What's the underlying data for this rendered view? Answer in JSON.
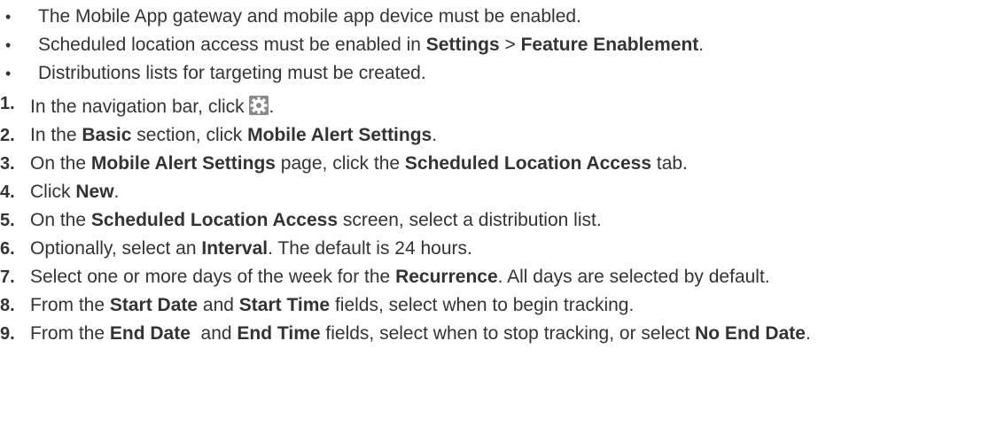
{
  "prerequisites": [
    {
      "parts": [
        {
          "t": "The Mobile App gateway and mobile app device must be enabled.",
          "b": false
        }
      ]
    },
    {
      "parts": [
        {
          "t": "Scheduled location access must be enabled in ",
          "b": false
        },
        {
          "t": "Settings",
          "b": true
        },
        {
          "t": " > ",
          "b": false
        },
        {
          "t": "Feature Enablement",
          "b": true
        },
        {
          "t": ".",
          "b": false
        }
      ]
    },
    {
      "parts": [
        {
          "t": "Distributions lists for targeting must be created.",
          "b": false
        }
      ]
    }
  ],
  "steps": [
    {
      "num": "1.",
      "parts": [
        {
          "t": "In the navigation bar, click ",
          "b": false
        },
        {
          "icon": "gear-icon"
        },
        {
          "t": ".",
          "b": false
        }
      ]
    },
    {
      "num": "2.",
      "parts": [
        {
          "t": "In the ",
          "b": false
        },
        {
          "t": "Basic",
          "b": true
        },
        {
          "t": " section, click ",
          "b": false
        },
        {
          "t": "Mobile Alert Settings",
          "b": true
        },
        {
          "t": ".",
          "b": false
        }
      ]
    },
    {
      "num": "3.",
      "parts": [
        {
          "t": "On the ",
          "b": false
        },
        {
          "t": "Mobile Alert Settings",
          "b": true
        },
        {
          "t": " page, click the ",
          "b": false
        },
        {
          "t": "Scheduled Location Access",
          "b": true
        },
        {
          "t": " tab.",
          "b": false
        }
      ]
    },
    {
      "num": "4.",
      "parts": [
        {
          "t": "Click ",
          "b": false
        },
        {
          "t": "New",
          "b": true
        },
        {
          "t": ".",
          "b": false
        }
      ]
    },
    {
      "num": "5.",
      "parts": [
        {
          "t": "On the ",
          "b": false
        },
        {
          "t": "Scheduled Location Access",
          "b": true
        },
        {
          "t": " screen, select a distribution list.",
          "b": false
        }
      ]
    },
    {
      "num": "6.",
      "parts": [
        {
          "t": "Optionally, select an ",
          "b": false
        },
        {
          "t": "Interval",
          "b": true
        },
        {
          "t": ". The default is 24 hours.",
          "b": false
        }
      ]
    },
    {
      "num": "7.",
      "parts": [
        {
          "t": "Select one or more days of the week for the ",
          "b": false
        },
        {
          "t": "Recurrence",
          "b": true
        },
        {
          "t": ". All days are selected by default.",
          "b": false
        }
      ]
    },
    {
      "num": "8.",
      "parts": [
        {
          "t": "From the ",
          "b": false
        },
        {
          "t": "Start Date",
          "b": true
        },
        {
          "t": " and ",
          "b": false
        },
        {
          "t": "Start Time",
          "b": true
        },
        {
          "t": " fields, select when to begin tracking.",
          "b": false
        }
      ]
    },
    {
      "num": "9.",
      "parts": [
        {
          "t": "From the ",
          "b": false
        },
        {
          "t": "End Date",
          "b": true
        },
        {
          "t": "  and ",
          "b": false
        },
        {
          "t": "End Time",
          "b": true
        },
        {
          "t": " fields, select when to stop tracking, or select ",
          "b": false
        },
        {
          "t": "No End Date",
          "b": true
        },
        {
          "t": ".",
          "b": false
        }
      ]
    }
  ],
  "bullet_glyph": "•"
}
